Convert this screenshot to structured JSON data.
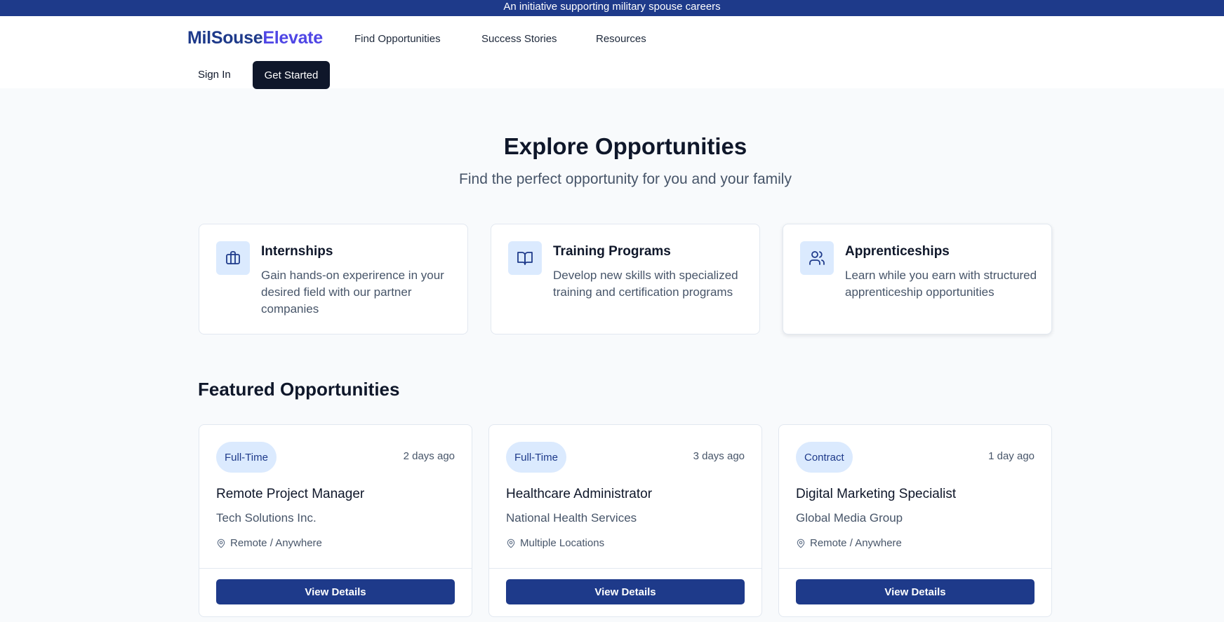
{
  "banner": {
    "text": "An initiative supporting military spouse careers"
  },
  "header": {
    "logo_part1": "MilSouse",
    "logo_part2": "Elevate",
    "nav": [
      {
        "label": "Find Opportunities"
      },
      {
        "label": "Success Stories"
      },
      {
        "label": "Resources"
      }
    ],
    "sign_in": "Sign In",
    "get_started": "Get Started"
  },
  "hero": {
    "title": "Explore Opportunities",
    "subtitle": "Find the perfect opportunity for you and your family"
  },
  "categories": [
    {
      "icon": "briefcase-icon",
      "title": "Internships",
      "description": "Gain hands-on experirence in your desired field with our partner companies"
    },
    {
      "icon": "book-open-icon",
      "title": "Training Programs",
      "description": "Develop new skills with specialized training and certification programs"
    },
    {
      "icon": "users-icon",
      "title": "Apprenticeships",
      "description": "Learn while you earn with structured apprenticeship opportunities"
    }
  ],
  "featured": {
    "title": "Featured Opportunities",
    "jobs": [
      {
        "type": "Full-Time",
        "posted": "2 days ago",
        "title": "Remote Project Manager",
        "company": "Tech Solutions Inc.",
        "location": "Remote / Anywhere",
        "button": "View Details"
      },
      {
        "type": "Full-Time",
        "posted": "3 days ago",
        "title": "Healthcare Administrator",
        "company": "National Health Services",
        "location": "Multiple Locations",
        "button": "View Details"
      },
      {
        "type": "Contract",
        "posted": "1 day ago",
        "title": "Digital Marketing Specialist",
        "company": "Global Media Group",
        "location": "Remote / Anywhere",
        "button": "View Details"
      }
    ]
  },
  "colors": {
    "brand_navy": "#1e3a8a",
    "brand_indigo": "#4f46e5",
    "dark": "#0f172a",
    "badge_bg": "#dbeafe"
  }
}
